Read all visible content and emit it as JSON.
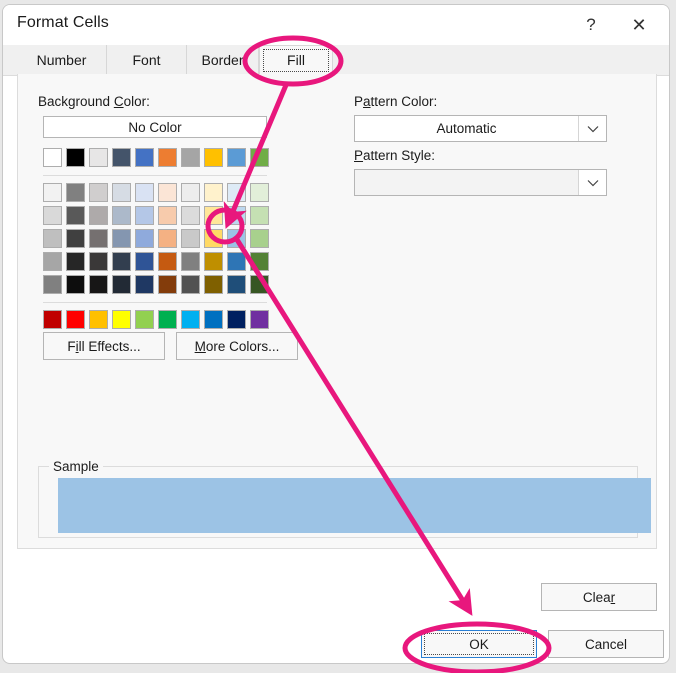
{
  "window": {
    "title": "Format Cells",
    "help_label": "?",
    "close_label": "✕"
  },
  "tabs": [
    {
      "label": "Number",
      "selected": false
    },
    {
      "label": "Font",
      "selected": false
    },
    {
      "label": "Border",
      "selected": false
    },
    {
      "label": "Fill",
      "selected": true
    }
  ],
  "fill_panel": {
    "background_color_label_pre": "Background ",
    "background_color_label_key": "C",
    "background_color_label_post": "olor:",
    "no_color_label": "No Color",
    "pattern_color_label_pre": "P",
    "pattern_color_label_key": "a",
    "pattern_color_label_post": "ttern Color:",
    "pattern_color_value": "Automatic",
    "pattern_style_label_pre": "",
    "pattern_style_label_key": "P",
    "pattern_style_label_post": "attern Style:",
    "pattern_style_value": "",
    "fill_effects_label_pre": "F",
    "fill_effects_label_key": "i",
    "fill_effects_label_post": "ll Effects...",
    "more_colors_label_pre": "",
    "more_colors_label_key": "M",
    "more_colors_label_post": "ore Colors...",
    "sample_legend": "Sample",
    "sample_fill_color": "#9CC3E5",
    "selected_swatch": {
      "row": 3,
      "column": 9,
      "color": "#9CC3E5"
    }
  },
  "palette": {
    "theme_row": [
      "#FFFFFF",
      "#000000",
      "#E7E6E6",
      "#44546A",
      "#4472C4",
      "#ED7D31",
      "#A5A5A5",
      "#FFC000",
      "#5B9BD5",
      "#70AD47"
    ],
    "tint_rows": [
      [
        "#F2F2F2",
        "#808080",
        "#D0CECE",
        "#D6DCE4",
        "#D9E2F3",
        "#FBE5D6",
        "#EDEDED",
        "#FFF2CC",
        "#DEEBF6",
        "#E2EFD9"
      ],
      [
        "#D9D9D9",
        "#595959",
        "#AEAAAA",
        "#ACB9CA",
        "#B4C7E7",
        "#F7CBAC",
        "#DBDBDB",
        "#FFE699",
        "#BDD7EE",
        "#C5E0B3"
      ],
      [
        "#BFBFBF",
        "#404040",
        "#757070",
        "#8496B0",
        "#8FAADC",
        "#F4B183",
        "#C9C9C9",
        "#FFD965",
        "#9CC3E5",
        "#A8D08D"
      ],
      [
        "#A6A6A6",
        "#262626",
        "#3A3838",
        "#323E4F",
        "#2F5496",
        "#C55A11",
        "#808080",
        "#BF8F00",
        "#2E75B5",
        "#538135"
      ],
      [
        "#808080",
        "#0D0D0D",
        "#171616",
        "#222A35",
        "#1F3863",
        "#833C0B",
        "#525252",
        "#7F6000",
        "#1F4E79",
        "#375623"
      ]
    ],
    "standard_row": [
      "#C00000",
      "#FF0000",
      "#FFC000",
      "#FFFF00",
      "#92D050",
      "#00B050",
      "#00B0F0",
      "#0070C0",
      "#002060",
      "#7030A0"
    ]
  },
  "footer": {
    "clear_label_pre": "Clea",
    "clear_label_key": "r",
    "clear_label_post": "",
    "ok_label": "OK",
    "cancel_label": "Cancel"
  },
  "annotations": {
    "accent_color": "#E8177D",
    "ellipse_fill_tab": "circles the Fill tab",
    "ellipse_swatch": "circles the light blue swatch",
    "ellipse_ok": "circles the OK button"
  }
}
